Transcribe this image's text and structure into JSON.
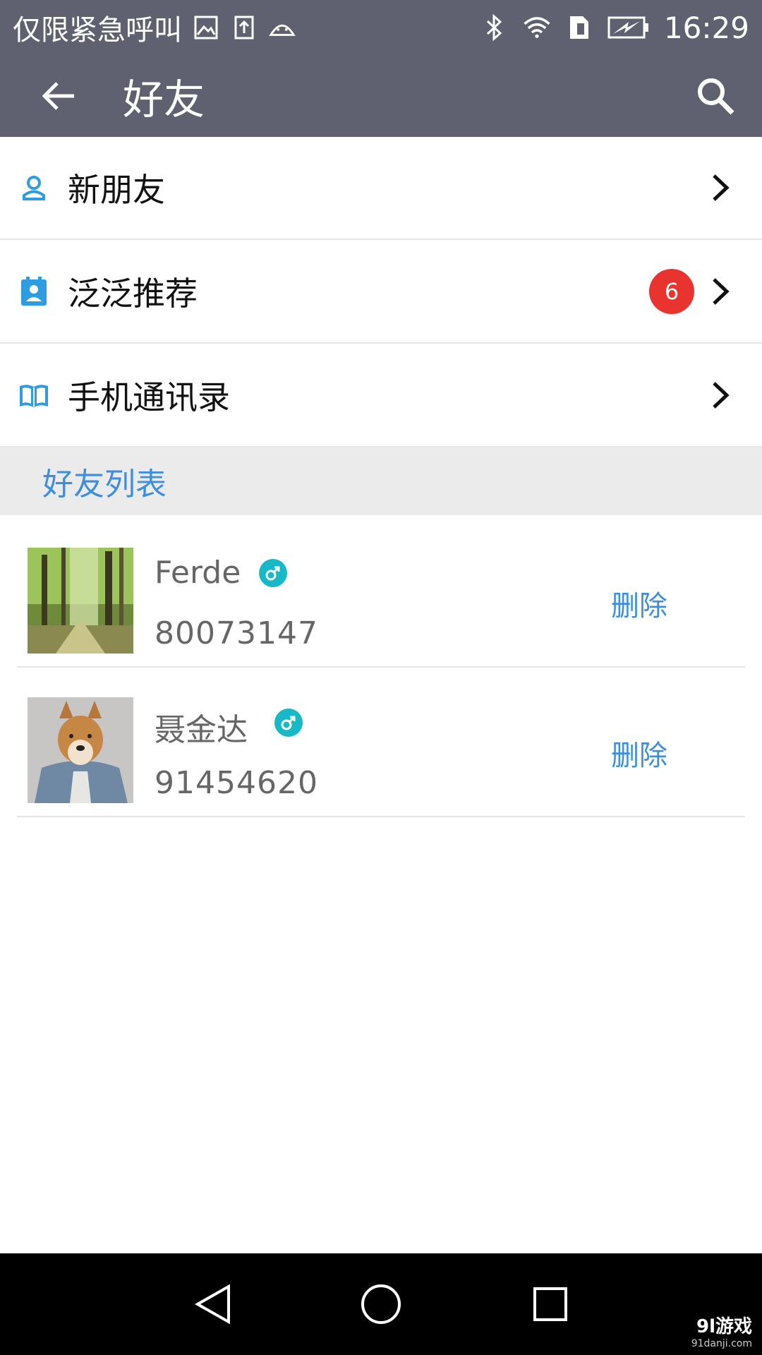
{
  "status_bar": {
    "carrier_text": "仅限紧急呼叫",
    "time": "16:29",
    "icons_left": [
      "gallery-icon",
      "upload-icon",
      "android-icon"
    ],
    "icons_right": [
      "bluetooth-icon",
      "wifi-icon",
      "sim-icon",
      "battery-charging-icon"
    ]
  },
  "app_bar": {
    "title": "好友",
    "back_icon": "arrow-left-icon",
    "search_icon": "search-icon"
  },
  "menu": [
    {
      "label": "新朋友",
      "icon": "person-icon",
      "badge": ""
    },
    {
      "label": "泛泛推荐",
      "icon": "contact-card-icon",
      "badge": "6"
    },
    {
      "label": "手机通讯录",
      "icon": "book-icon",
      "badge": ""
    }
  ],
  "section": {
    "title": "好友列表"
  },
  "friends": [
    {
      "name": "Ferde",
      "id": "80073147",
      "gender": "male",
      "delete_label": "删除",
      "avatar": "forest-avatar"
    },
    {
      "name": "聂金达",
      "id": "91454620",
      "gender": "male",
      "delete_label": "删除",
      "avatar": "dog-avatar"
    }
  ],
  "watermark": {
    "main": "9l游戏",
    "sub": "91danji.com"
  },
  "colors": {
    "bar": "#5f6170",
    "accent": "#3d8fde",
    "badge": "#e8332f",
    "gender": "#19b8c6"
  }
}
